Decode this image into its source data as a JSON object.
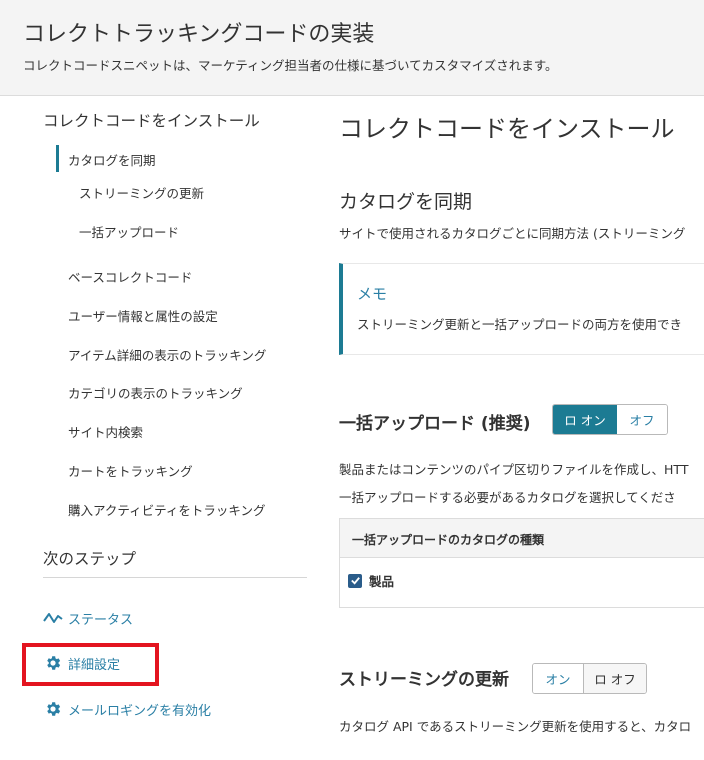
{
  "header": {
    "title": "コレクトトラッキングコードの実装",
    "subtitle": "コレクトコードスニペットは、マーケティング担当者の仕様に基づいてカスタマイズされます。"
  },
  "sidebar": {
    "heading_install": "コレクトコードをインストール",
    "items": [
      {
        "label": "カタログを同期"
      },
      {
        "label": "ストリーミングの更新"
      },
      {
        "label": "一括アップロード"
      },
      {
        "label": "ベースコレクトコード"
      },
      {
        "label": "ユーザー情報と属性の設定"
      },
      {
        "label": "アイテム詳細の表示のトラッキング"
      },
      {
        "label": "カテゴリの表示のトラッキング"
      },
      {
        "label": "サイト内検索"
      },
      {
        "label": "カートをトラッキング"
      },
      {
        "label": "購入アクティビティをトラッキング"
      }
    ],
    "heading_next": "次のステップ",
    "links": [
      {
        "label": "ステータス",
        "icon": "pulse-icon"
      },
      {
        "label": "詳細設定",
        "icon": "gear-icon"
      },
      {
        "label": "メールロギングを有効化",
        "icon": "gear-icon"
      }
    ]
  },
  "main": {
    "title": "コレクトコードをインストール",
    "sync_heading": "カタログを同期",
    "sync_text": "サイトで使用されるカタログごとに同期方法 (ストリーミング",
    "note": {
      "title": "メモ",
      "text": "ストリーミング更新と一括アップロードの両方を使用でき"
    },
    "bulk": {
      "heading": "一括アップロード (推奨)",
      "toggle_on": "ロ オン",
      "toggle_off": "オフ",
      "text1": "製品またはコンテンツのパイプ区切りファイルを作成し、HTT",
      "text2": "一括アップロードする必要があるカタログを選択してくださ",
      "table_header": "一括アップロードのカタログの種類",
      "row_label": "製品"
    },
    "streaming": {
      "heading": "ストリーミングの更新",
      "toggle_on": "オン",
      "toggle_off": "ロ オフ",
      "text": "カタログ API であるストリーミング更新を使用すると、カタロ"
    }
  },
  "colors": {
    "accent": "#1c7b93",
    "link": "#2a7fa5",
    "highlight": "#e3141f"
  }
}
